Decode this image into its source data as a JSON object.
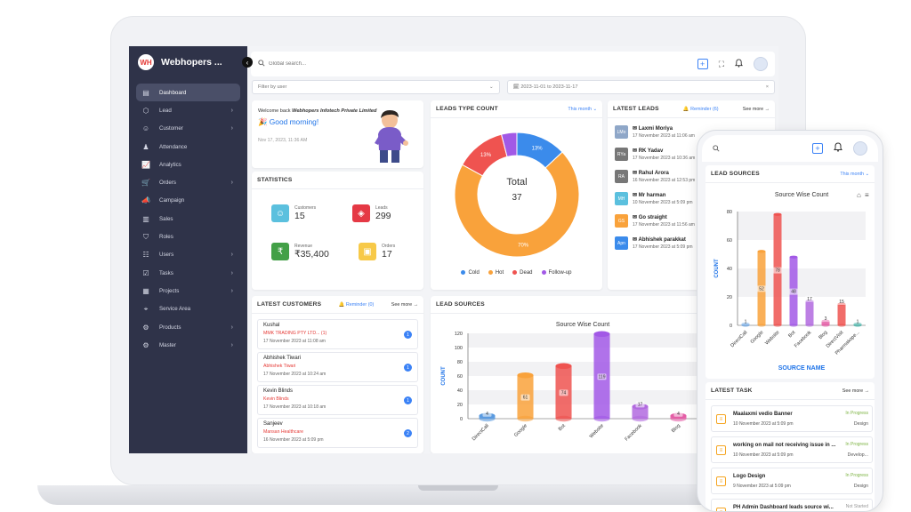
{
  "brand": {
    "name": "Webhopers ...",
    "logo": "WH"
  },
  "search": {
    "placeholder": "Global search..."
  },
  "filters": {
    "user_placeholder": "Filter by user",
    "date_range": "2023-11-01 to 2023-11-17"
  },
  "sidebar": {
    "items": [
      {
        "label": "Dashboard",
        "icon": "dashboard-icon"
      },
      {
        "label": "Lead",
        "icon": "lead-icon"
      },
      {
        "label": "Customer",
        "icon": "customer-icon"
      },
      {
        "label": "Attendance",
        "icon": "attendance-icon"
      },
      {
        "label": "Analytics",
        "icon": "analytics-icon"
      },
      {
        "label": "Orders",
        "icon": "orders-icon"
      },
      {
        "label": "Campaign",
        "icon": "campaign-icon"
      },
      {
        "label": "Sales",
        "icon": "sales-icon"
      },
      {
        "label": "Roles",
        "icon": "roles-icon"
      },
      {
        "label": "Users",
        "icon": "users-icon"
      },
      {
        "label": "Tasks",
        "icon": "tasks-icon"
      },
      {
        "label": "Projects",
        "icon": "projects-icon"
      },
      {
        "label": "Service Area",
        "icon": "location-icon"
      },
      {
        "label": "Products",
        "icon": "products-icon"
      },
      {
        "label": "Master",
        "icon": "master-icon"
      }
    ]
  },
  "welcome": {
    "line1_prefix": "Welcome back ",
    "company": "Webhopers Infotech Private Limited",
    "greeting": "Good morning!",
    "datetime": "Nov 17, 2023, 11:36 AM"
  },
  "statistics": {
    "title": "STATISTICS",
    "items": [
      {
        "label": "Customers",
        "value": "15",
        "color": "#5bc0de"
      },
      {
        "label": "Leads",
        "value": "299",
        "color": "#e53945"
      },
      {
        "label": "Revenue",
        "value": "₹35,400",
        "color": "#43a047"
      },
      {
        "label": "Orders",
        "value": "17",
        "color": "#f7c948"
      }
    ]
  },
  "leads_type": {
    "title": "LEADS TYPE COUNT",
    "filter": "This month",
    "total_label": "Total",
    "total_value": "37",
    "legend": [
      {
        "name": "Cold",
        "color": "#3b8beb"
      },
      {
        "name": "Hot",
        "color": "#f9a23b"
      },
      {
        "name": "Dead",
        "color": "#ef5350"
      },
      {
        "name": "Follow-up",
        "color": "#a259e6"
      }
    ],
    "slice_labels": [
      "13%",
      "70%",
      "13%"
    ]
  },
  "latest_leads": {
    "title": "LATEST LEADS",
    "reminder": "Reminder (6)",
    "see_more": "See more",
    "items": [
      {
        "initials": "LMo",
        "name": "Laxmi Moriya",
        "date": "17 November 2023 at 11:06 am",
        "color": "#8fa7c8"
      },
      {
        "initials": "RYa",
        "name": "RK Yadav",
        "date": "17 November 2023 at 10:36 am",
        "color": "#777"
      },
      {
        "initials": "RA",
        "name": "Rahul Arora",
        "date": "16 November 2023 at 12:53 pm",
        "color": "#777"
      },
      {
        "initials": "MH",
        "name": "Mr harman",
        "date": "10 November 2023 at 5:09 pm",
        "color": "#5bc0de"
      },
      {
        "initials": "GS",
        "name": "Go straight",
        "date": "17 November 2023 at 11:56 am",
        "color": "#f9a23b"
      },
      {
        "initials": "Apn",
        "name": "Abhishek parakkat",
        "date": "17 November 2023 at 5:09 pm",
        "color": "#3b8beb"
      }
    ]
  },
  "latest_customers": {
    "title": "LATEST CUSTOMERS",
    "reminder": "Reminder (0)",
    "see_more": "See more",
    "items": [
      {
        "name": "Kushal",
        "company": "MMK TRADING PTY LTD... (1)",
        "date": "17 November 2023 at 11:08 am",
        "badge": "1"
      },
      {
        "name": "Abhishek Tiwari",
        "company": "Abhishek Tiwari",
        "date": "17 November 2023 at 10:24 am",
        "badge": "1"
      },
      {
        "name": "Kevin Blinds",
        "company": "Kevin Blinds",
        "date": "17 November 2023 at 10:18 am",
        "badge": "1"
      },
      {
        "name": "Sanjeev",
        "company": "Mansan Healthcare",
        "date": "16 November 2023 at 5:09 pm",
        "badge": "2"
      }
    ]
  },
  "lead_sources": {
    "title": "LEAD SOURCES",
    "chart_title": "Source Wise Count",
    "ylabel": "COUNT"
  },
  "phone": {
    "lead_sources_title": "LEAD SOURCES",
    "filter": "This month",
    "chart_title": "Source Wise Count",
    "xlabel": "SOURCE NAME",
    "ylabel": "COUNT",
    "latest_task_title": "LATEST TASK",
    "see_more": "See more",
    "tasks": [
      {
        "name": "Maalaxmi vedio Banner",
        "date": "10 November 2023 at 5:09 pm",
        "status": "In Progress",
        "category": "Design",
        "status_color": "#7cb342"
      },
      {
        "name": "working on mail not receiving issue in ...",
        "date": "10 November 2023 at 5:09 pm",
        "status": "In Progress",
        "category": "Develop...",
        "status_color": "#7cb342"
      },
      {
        "name": "Logo Design",
        "date": "9 November 2023 at 5:09 pm",
        "status": "In Progress",
        "category": "Design",
        "status_color": "#7cb342"
      },
      {
        "name": "PH Admin Dashboard leads source wi...",
        "date": "",
        "status": "Not Started",
        "category": "",
        "status_color": "#999"
      }
    ]
  },
  "chart_data": [
    {
      "type": "pie",
      "title": "LEADS TYPE COUNT",
      "categories": [
        "Cold",
        "Hot",
        "Dead",
        "Follow-up"
      ],
      "values": [
        13,
        70,
        13,
        4
      ],
      "unit": "%",
      "total": 37
    },
    {
      "type": "bar",
      "title": "Source Wise Count",
      "categories": [
        "DirectCall",
        "Google",
        "Bot",
        "Website",
        "Facebook",
        "Blog"
      ],
      "values": [
        4,
        61,
        74,
        119,
        17,
        4
      ],
      "ylabel": "COUNT",
      "ylim": [
        0,
        120
      ],
      "yticks": [
        0,
        20,
        40,
        60,
        80,
        100,
        120
      ]
    },
    {
      "type": "bar",
      "title": "Source Wise Count",
      "categories": [
        "DirectCall",
        "Google",
        "Website",
        "Bot",
        "Facebook",
        "Blog",
        "DirectVisit",
        "Pharmakope..."
      ],
      "values": [
        1,
        52,
        78,
        48,
        17,
        3,
        15,
        1
      ],
      "xlabel": "SOURCE NAME",
      "ylabel": "COUNT",
      "ylim": [
        0,
        80
      ],
      "yticks": [
        0,
        20,
        40,
        60,
        80
      ]
    }
  ]
}
